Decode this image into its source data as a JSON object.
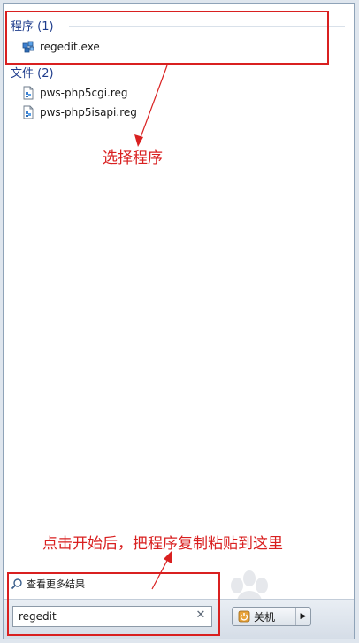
{
  "groups": {
    "programs": {
      "header": "程序 (1)",
      "items": [
        {
          "label": "regedit.exe",
          "icon": "regedit-icon"
        }
      ]
    },
    "files": {
      "header": "文件 (2)",
      "items": [
        {
          "label": "pws-php5cgi.reg",
          "icon": "reg-file-icon"
        },
        {
          "label": "pws-php5isapi.reg",
          "icon": "reg-file-icon"
        }
      ]
    }
  },
  "annotations": {
    "select_program": "选择程序",
    "paste_instruction": "点击开始后，把程序复制粘贴到这里"
  },
  "more_results": {
    "label": "查看更多结果",
    "icon": "search-icon"
  },
  "search": {
    "value": "regedit",
    "clear_icon": "close-icon"
  },
  "shutdown": {
    "label": "关机",
    "icon": "shutdown-icon",
    "arrow_icon": "chevron-right-icon"
  },
  "colors": {
    "annotation_red": "#d92020",
    "group_header_blue": "#1e3c8c"
  }
}
